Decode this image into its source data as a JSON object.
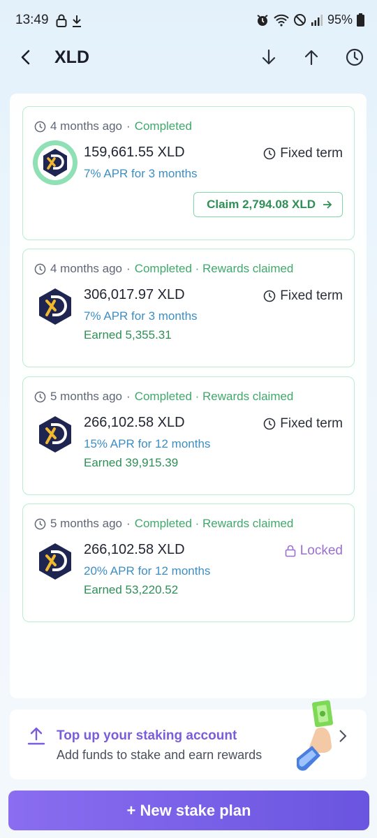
{
  "status_bar": {
    "time": "13:49",
    "battery": "95%"
  },
  "header": {
    "title": "XLD"
  },
  "stakes": [
    {
      "time_ago": "4 months ago",
      "status": "Completed",
      "amount": "159,661.55 XLD",
      "apr": "7% APR for 3 months",
      "term": "Fixed term",
      "claim_label": "Claim 2,794.08 XLD"
    },
    {
      "time_ago": "4 months ago",
      "status": "Completed · Rewards claimed",
      "amount": "306,017.97 XLD",
      "apr": "7% APR for 3 months",
      "term": "Fixed term",
      "earned": "Earned 5,355.31"
    },
    {
      "time_ago": "5 months ago",
      "status": "Completed · Rewards claimed",
      "amount": "266,102.58 XLD",
      "apr": "15% APR for 12 months",
      "term": "Fixed term",
      "earned": "Earned 39,915.39"
    },
    {
      "time_ago": "5 months ago",
      "status": "Completed · Rewards claimed",
      "amount": "266,102.58 XLD",
      "apr": "20% APR for 12 months",
      "term": "Locked",
      "earned": "Earned 53,220.52"
    }
  ],
  "topup": {
    "title": "Top up your staking account",
    "subtitle": "Add funds to stake and earn rewards"
  },
  "new_stake_button": "+ New stake plan",
  "colors": {
    "accent": "#7b5ddb",
    "completed": "#3fa86b",
    "apr": "#3d8ec4",
    "card_border": "#b9ecd1"
  }
}
